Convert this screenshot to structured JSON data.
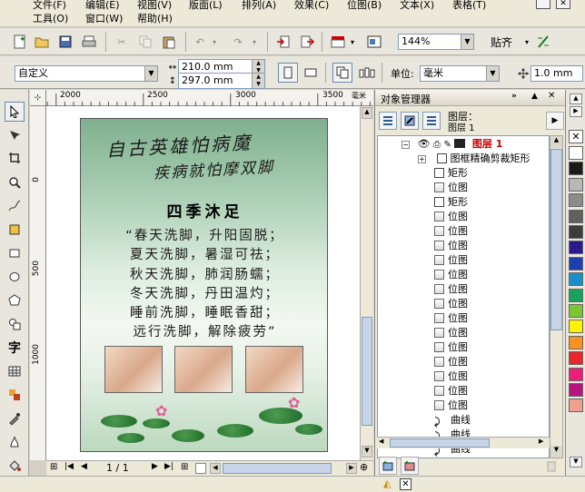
{
  "menu": {
    "file": "文件(F)",
    "edit": "编辑(E)",
    "view": "视图(V)",
    "layout": "版面(L)",
    "arrange": "排列(A)",
    "effects": "效果(C)",
    "bitmap": "位图(B)",
    "text": "文本(X)",
    "table": "表格(T)",
    "tools": "工具(O)",
    "window": "窗口(W)",
    "help": "帮助(H)"
  },
  "toolbar": {
    "zoom": "144%",
    "snap_label": "贴齐"
  },
  "property_bar": {
    "paper_preset": "自定义",
    "width": "210.0 mm",
    "height": "297.0 mm",
    "unit_label": "单位:",
    "unit_value": "毫米",
    "nudge": "1.0 mm"
  },
  "ruler": {
    "h_labels": [
      "2000",
      "2500",
      "3000",
      "3500"
    ],
    "h_unit": "毫米",
    "v_labels": [
      "0",
      "500",
      "1000"
    ]
  },
  "poster": {
    "line1": "自古英雄怕病魔",
    "line2": "疾病就怕摩双脚",
    "heading": "四季沐足",
    "verses": [
      "“春天洗脚，升阳固脱；",
      "夏天洗脚，暑湿可祛；",
      "秋天洗脚，肺润肠蠕；",
      "冬天洗脚，丹田温灼；",
      "睡前洗脚，睡眠香甜；",
      "远行洗脚，解除疲劳”"
    ]
  },
  "page_nav": {
    "page_counter": "1 / 1"
  },
  "panel": {
    "title": "对象管理器",
    "layer_heading": "图层：",
    "layer_name": "图层 1",
    "tree_layer": "图层 1",
    "tree_powerclip": "图框精确剪裁矩形",
    "tree_items": [
      "矩形",
      "位图",
      "矩形",
      "位图",
      "位图",
      "位图",
      "位图",
      "位图",
      "位图",
      "位图",
      "位图",
      "位图",
      "位图",
      "位图",
      "位图",
      "位图",
      "位图",
      "曲线",
      "曲线",
      "曲线"
    ]
  },
  "palette_colors": [
    "#ffffff",
    "#1a1a1a",
    "#b8b8b8",
    "#8c8c8c",
    "#606060",
    "#3c3c3c",
    "#2b1a8c",
    "#1f3fae",
    "#1b8ec8",
    "#17a45a",
    "#7ec532",
    "#fff200",
    "#f7931e",
    "#e8262d",
    "#ed1e79",
    "#b7137c",
    "#f0a090"
  ]
}
